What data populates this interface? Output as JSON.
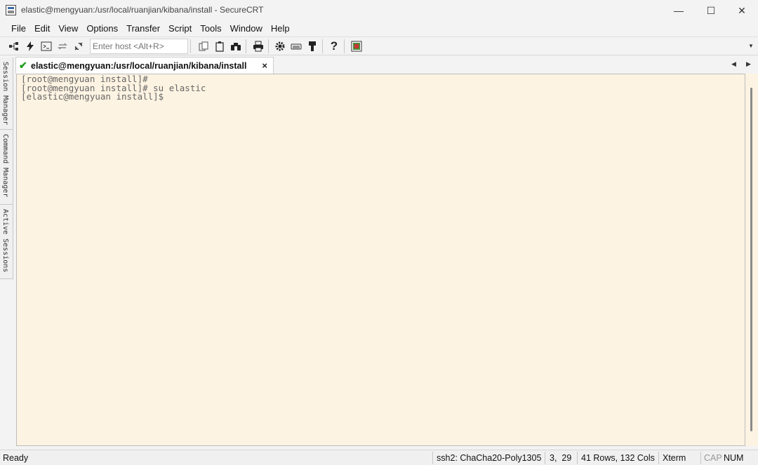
{
  "window": {
    "title": "elastic@mengyuan:/usr/local/ruanjian/kibana/install - SecureCRT",
    "app_icon": "securecrt-app-icon",
    "controls": {
      "minimize": "—",
      "maximize": "☐",
      "close": "✕"
    }
  },
  "menu": {
    "items": [
      "File",
      "Edit",
      "View",
      "Options",
      "Transfer",
      "Script",
      "Tools",
      "Window",
      "Help"
    ]
  },
  "toolbar": {
    "host_placeholder": "Enter host <Alt+R>",
    "icons": [
      "connect-icon",
      "quick-connect-icon",
      "connect-shell-icon",
      "reconnect-icon",
      "disconnect-icon",
      "copy-icon",
      "paste-icon",
      "find-icon",
      "print-icon",
      "settings-icon",
      "keymap-icon",
      "sftp-icon",
      "help-icon",
      "screenshot-icon"
    ]
  },
  "side_tabs": [
    "Session Manager",
    "Command Manager",
    "Active Sessions"
  ],
  "session_tab": {
    "label": "elastic@mengyuan:/usr/local/ruanjian/kibana/install",
    "status_icon": "check-icon",
    "close_icon": "×"
  },
  "terminal": {
    "lines": [
      "[root@mengyuan install]#",
      "[root@mengyuan install]# su elastic",
      "[elastic@mengyuan install]$"
    ],
    "background": "#fdf3e2",
    "text_color": "#666666"
  },
  "status": {
    "ready": "Ready",
    "cipher": "ssh2: ChaCha20-Poly1305",
    "cursor": "3,  29",
    "size": "41 Rows, 132 Cols",
    "terminal_type": "Xterm",
    "cap": "CAP",
    "num": "NUM"
  }
}
